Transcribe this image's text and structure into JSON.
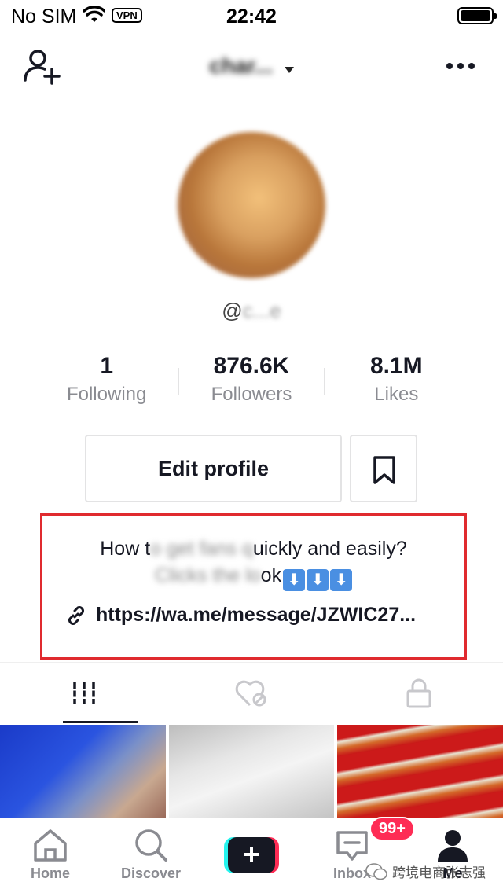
{
  "status_bar": {
    "carrier": "No SIM",
    "vpn": "VPN",
    "time": "22:42"
  },
  "header": {
    "profile_name": "char...",
    "add_friend_icon": "add-user-icon",
    "more_icon": "more-horizontal-icon"
  },
  "profile": {
    "handle_prefix": "@",
    "handle_blurred": "c...e",
    "stats": [
      {
        "value": "1",
        "label": "Following"
      },
      {
        "value": "876.6K",
        "label": "Followers"
      },
      {
        "value": "8.1M",
        "label": "Likes"
      }
    ],
    "edit_profile_label": "Edit profile"
  },
  "bio": {
    "line1_start": "How t",
    "line1_blur": "o get fans q",
    "line1_end": "uickly and easily?",
    "line2_blur": "Clicks the lo",
    "line2_end": "ok",
    "arrows": [
      "⬇",
      "⬇",
      "⬇"
    ],
    "link": "https://wa.me/message/JZWIC27..."
  },
  "tabs": [
    {
      "name": "videos",
      "icon": "grid-icon",
      "active": true
    },
    {
      "name": "liked",
      "icon": "hidden-heart-icon",
      "active": false
    },
    {
      "name": "private",
      "icon": "lock-icon",
      "active": false
    }
  ],
  "bottom_nav": {
    "home": "Home",
    "discover": "Discover",
    "create": "+",
    "inbox": "Inbox",
    "inbox_badge": "99+",
    "me": "Me"
  },
  "watermark": "跨境电商张志强",
  "colors": {
    "highlight_border": "#e02a2f",
    "badge": "#fe2c55",
    "create_cyan": "#25f4ee",
    "create_pink": "#fe2c55"
  }
}
